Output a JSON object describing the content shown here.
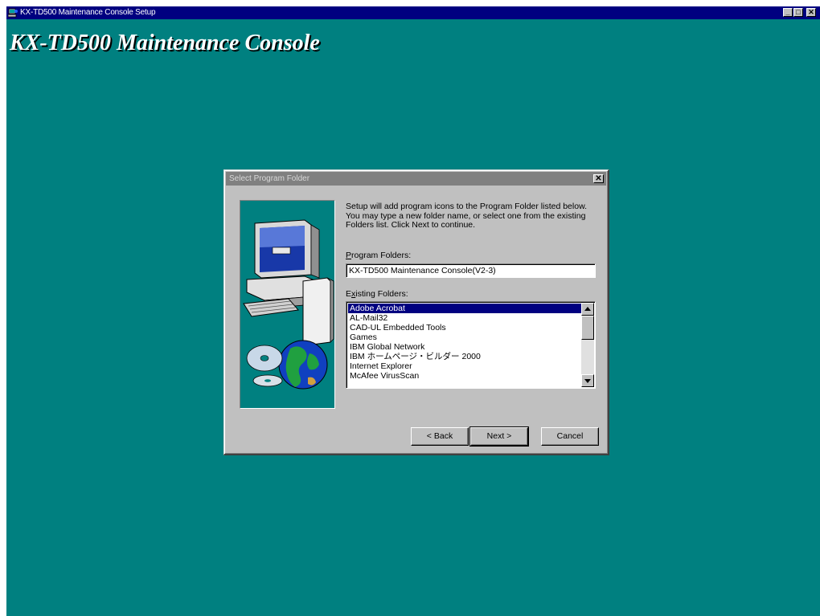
{
  "window": {
    "title": "KX-TD500 Maintenance Console Setup",
    "controls": {
      "minimize": "_",
      "maximize": "□",
      "close": "✕"
    }
  },
  "heading": "KX-TD500 Maintenance Console",
  "dialog": {
    "title": "Select Program Folder",
    "close": "✕",
    "description": "Setup will add program icons to the Program Folder listed below. You may type a new folder name, or select one from the existing Folders list.  Click Next to continue.",
    "program_folders_label_hotkey": "P",
    "program_folders_label_rest": "rogram Folders:",
    "program_folder_value": "KX-TD500 Maintenance Console(V2-3)",
    "existing_folders_label_pre": "E",
    "existing_folders_label_hotkey": "x",
    "existing_folders_label_rest": "isting Folders:",
    "existing_folders": [
      "Adobe Acrobat",
      "AL-Mail32",
      "CAD-UL Embedded Tools",
      "Games",
      "IBM Global Network",
      "IBM ホームページ・ビルダー 2000",
      "Internet Explorer",
      "McAfee VirusScan"
    ],
    "selected_index": 0,
    "buttons": {
      "back": "< Back",
      "next": "Next >",
      "cancel": "Cancel"
    }
  },
  "colors": {
    "desktop": "#008080",
    "titlebar": "#000080",
    "inactive_titlebar": "#808080",
    "face": "#c0c0c0",
    "selection": "#000080"
  }
}
